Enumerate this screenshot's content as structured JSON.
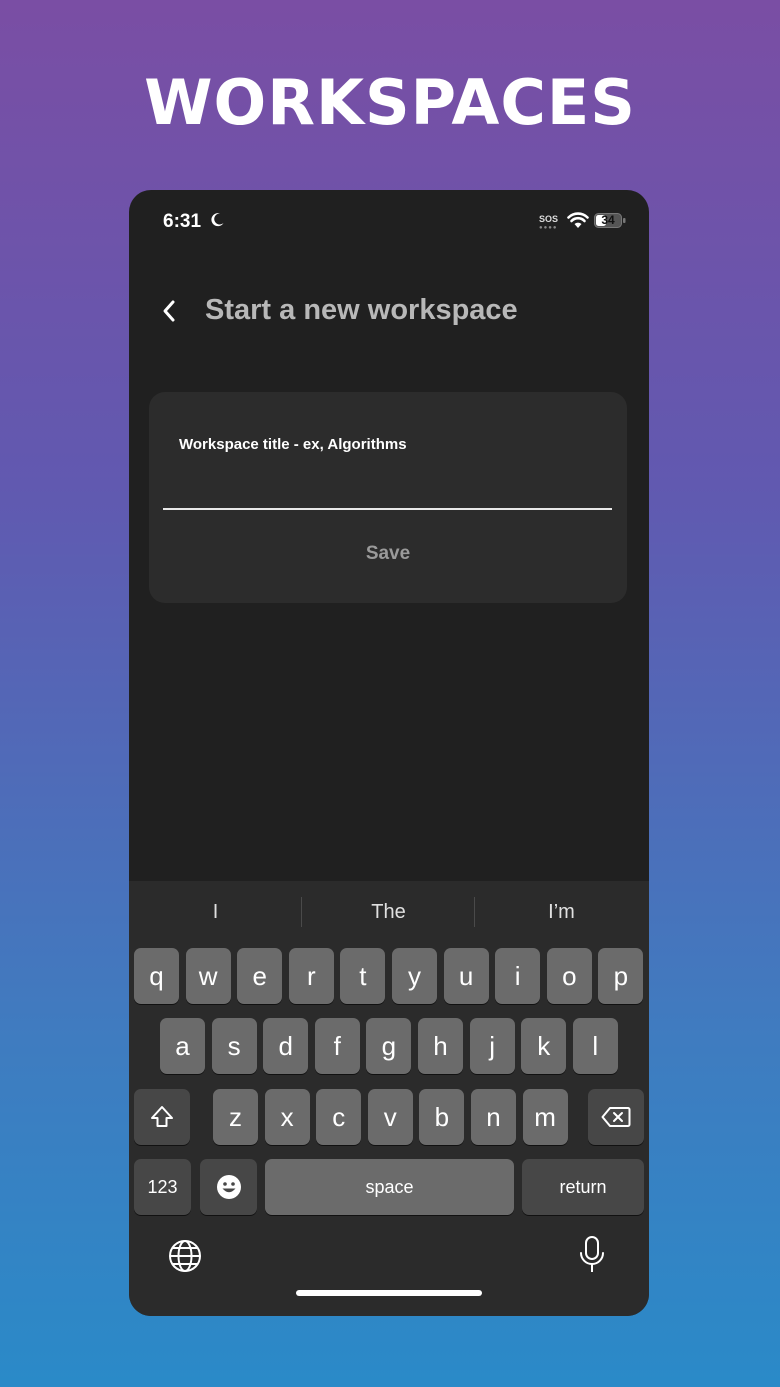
{
  "promo": {
    "title": "WORKSPACES"
  },
  "status_bar": {
    "time": "6:31",
    "carrier": "SOS",
    "battery": "34"
  },
  "nav": {
    "title": "Start a new workspace"
  },
  "form": {
    "field_label": "Workspace title - ex, Algorithms",
    "field_value": "",
    "save_label": "Save"
  },
  "keyboard": {
    "suggestions": [
      "I",
      "The",
      "I’m"
    ],
    "row1": [
      "q",
      "w",
      "e",
      "r",
      "t",
      "y",
      "u",
      "i",
      "o",
      "p"
    ],
    "row2": [
      "a",
      "s",
      "d",
      "f",
      "g",
      "h",
      "j",
      "k",
      "l"
    ],
    "row3": [
      "z",
      "x",
      "c",
      "v",
      "b",
      "n",
      "m"
    ],
    "numbers_label": "123",
    "space_label": "space",
    "return_label": "return",
    "icons": [
      "shift-icon",
      "delete-icon",
      "emoji-icon",
      "globe-icon",
      "mic-icon"
    ]
  }
}
